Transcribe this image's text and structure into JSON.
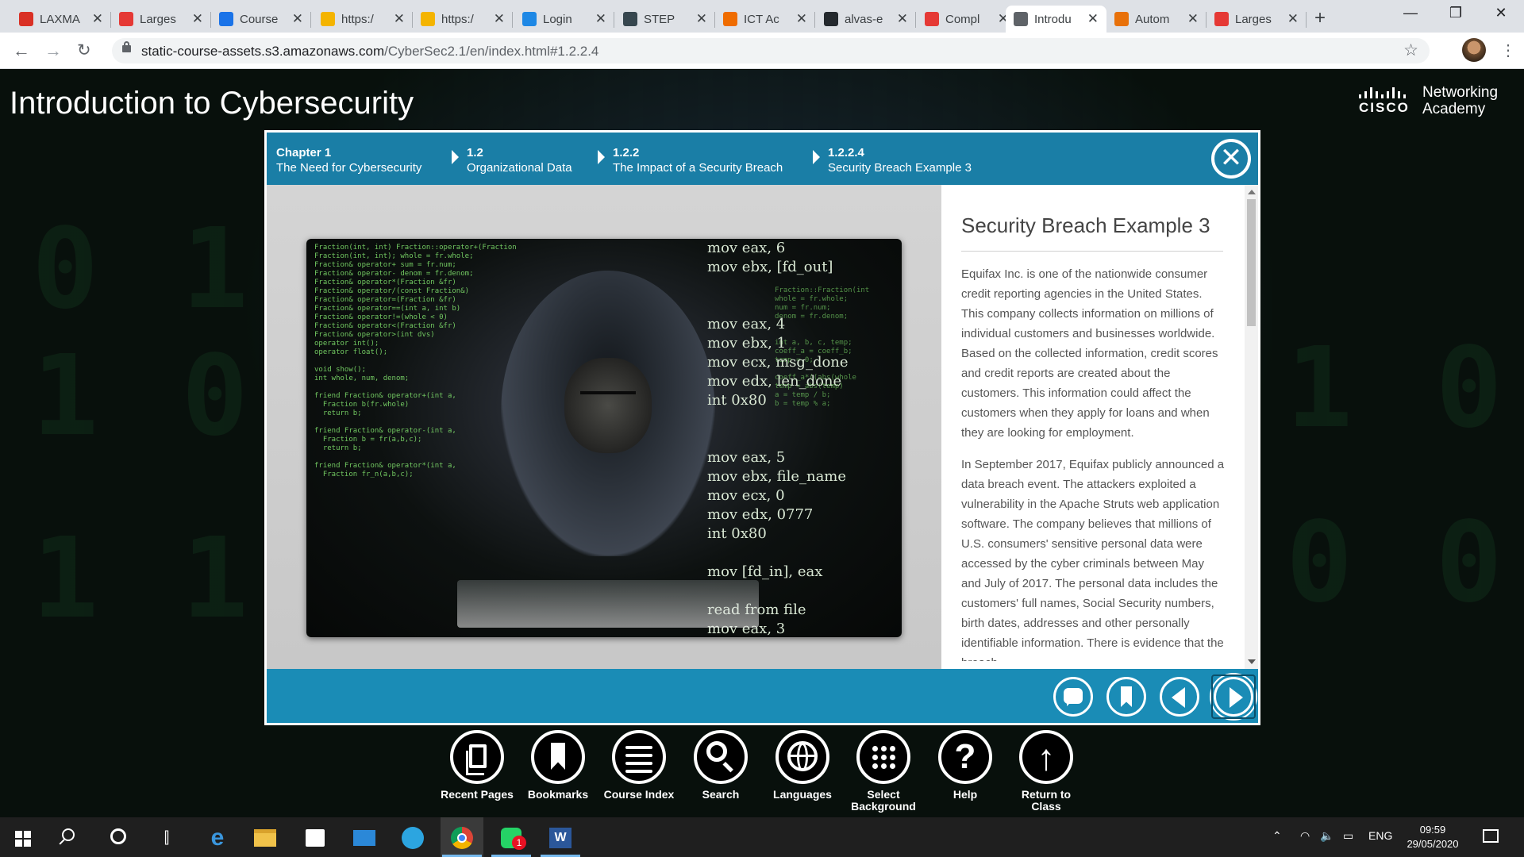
{
  "browser": {
    "tabs": [
      {
        "label": "LAXMA",
        "icon": "gmail-icon",
        "color": "#d93025"
      },
      {
        "label": "Larges",
        "icon": "tg-icon",
        "color": "#e53935"
      },
      {
        "label": "Course",
        "icon": "infinity-icon",
        "color": "#1a73e8"
      },
      {
        "label": "https:/",
        "icon": "yellow-favicon-icon",
        "color": "#f4b400"
      },
      {
        "label": "https:/",
        "icon": "yellow-favicon-icon",
        "color": "#f4b400"
      },
      {
        "label": "Login",
        "icon": "cloud-icon",
        "color": "#1e88e5"
      },
      {
        "label": "STEP",
        "icon": "step-icon",
        "color": "#37474f"
      },
      {
        "label": "ICT Ac",
        "icon": "ict-icon",
        "color": "#ef6c00"
      },
      {
        "label": "alvas-e",
        "icon": "github-icon",
        "color": "#24292e"
      },
      {
        "label": "Compl",
        "icon": "w-logo-icon",
        "color": "#e53935"
      },
      {
        "label": "Introdu",
        "icon": "globe-icon",
        "color": "#5f6368"
      },
      {
        "label": "Autom",
        "icon": "triangle-icon",
        "color": "#e8710a"
      },
      {
        "label": "Larges",
        "icon": "tg-icon",
        "color": "#e53935"
      }
    ],
    "url_host": "static-course-assets.s3.amazonaws.com",
    "url_path": "/CyberSec2.1/en/index.html#1.2.2.4"
  },
  "page": {
    "course_title": "Introduction to Cybersecurity",
    "logo_brand": "CISCO",
    "logo_line1": "Networking",
    "logo_line2": "Academy"
  },
  "breadcrumbs": [
    {
      "num": "Chapter 1",
      "label": "The Need for Cybersecurity"
    },
    {
      "num": "1.2",
      "label": "Organizational Data"
    },
    {
      "num": "1.2.2",
      "label": "The Impact of a Security Breach"
    },
    {
      "num": "1.2.2.4",
      "label": "Security Breach Example 3"
    }
  ],
  "panel": {
    "title": "Security Breach Example 3",
    "p1": "Equifax Inc. is one of the nationwide consumer credit reporting agencies in the United States. This company collects information on millions of individual customers and businesses worldwide. Based on the collected information, credit scores and credit reports are created about the customers. This information could affect the customers when they apply for loans and when they are looking for employment.",
    "p2": "In September 2017, Equifax publicly announced a data breach event. The attackers exploited a vulnerability in the Apache Struts web application software. The company believes that millions of U.S. consumers' sensitive personal data were accessed by the cyber criminals between May and July of 2017. The personal data includes the customers' full names, Social Security numbers, birth dates, addresses and other personally identifiable information. There is evidence that the breach"
  },
  "image_text": {
    "asm": "mov eax, 6\nmov ebx, [fd_out]\n\n\nmov eax, 4\nmov ebx, 1\nmov ecx, msg_done\nmov edx, len_done\nint 0x80\n\n\nmov eax, 5\nmov ebx, file_name\nmov ecx, 0\nmov edx, 0777\nint 0x80\n\nmov [fd_in], eax\n\nread from file\nmov eax, 3"
  },
  "tools": [
    {
      "label": "Recent Pages",
      "icon": "recent-pages-icon"
    },
    {
      "label": "Bookmarks",
      "icon": "bookmark-icon"
    },
    {
      "label": "Course Index",
      "icon": "menu-icon"
    },
    {
      "label": "Search",
      "icon": "search-icon"
    },
    {
      "label": "Languages",
      "icon": "globe-icon"
    },
    {
      "label": "Select Background",
      "icon": "grid-dots-icon"
    },
    {
      "label": "Help",
      "icon": "help-icon"
    },
    {
      "label": "Return to Class",
      "icon": "arrow-up-icon"
    }
  ],
  "taskbar": {
    "lang": "ENG",
    "time": "09:59",
    "date": "29/05/2020",
    "whatsapp_badge": "1"
  },
  "colors": {
    "accent": "#1a8cb6",
    "breadcrumb_bg": "#1a7ea6"
  }
}
